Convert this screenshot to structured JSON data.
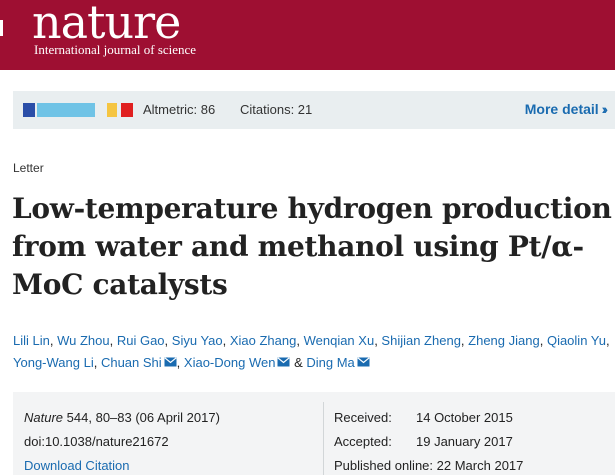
{
  "masthead": {
    "logo": "nature",
    "tagline": "International journal of science"
  },
  "metrics": {
    "donut_colors": [
      "#2b4ea8",
      "#6fc3e6",
      "#f5c542",
      "#e02020"
    ],
    "altmetric_label": "Altmetric: 86",
    "citations_label": "Citations: 21",
    "more_detail_label": "More detail",
    "more_detail_icon": "double-chevron-right-icon"
  },
  "article": {
    "type": "Letter",
    "title": "Low-temperature hydrogen production from water and methanol using Pt/α-MoC catalysts",
    "authors": [
      {
        "name": "Lili Lin",
        "mail": false
      },
      {
        "name": "Wu Zhou",
        "mail": false
      },
      {
        "name": "Rui Gao",
        "mail": false
      },
      {
        "name": "Siyu Yao",
        "mail": false
      },
      {
        "name": "Xiao Zhang",
        "mail": false
      },
      {
        "name": "Wenqian Xu",
        "mail": false
      },
      {
        "name": "Shijian Zheng",
        "mail": false
      },
      {
        "name": "Zheng Jiang",
        "mail": false
      },
      {
        "name": "Qiaolin Yu",
        "mail": false
      },
      {
        "name": "Yong-Wang Li",
        "mail": false
      },
      {
        "name": "Chuan Shi",
        "mail": true
      },
      {
        "name": "Xiao-Dong Wen",
        "mail": true
      },
      {
        "name": "Ding Ma",
        "mail": true
      }
    ],
    "author_separator": ", ",
    "author_last_separator": " & "
  },
  "info": {
    "journal": "Nature",
    "volume": "544",
    "pages": ", 80–83 (06 April 2017)",
    "doi": "doi:10.1038/nature21672",
    "download_citation": "Download Citation",
    "received_label": "Received:",
    "received_date": "14 October 2015",
    "accepted_label": "Accepted:",
    "accepted_date": "19 January 2017",
    "published_label": "Published online:",
    "published_date": "22 March 2017"
  }
}
